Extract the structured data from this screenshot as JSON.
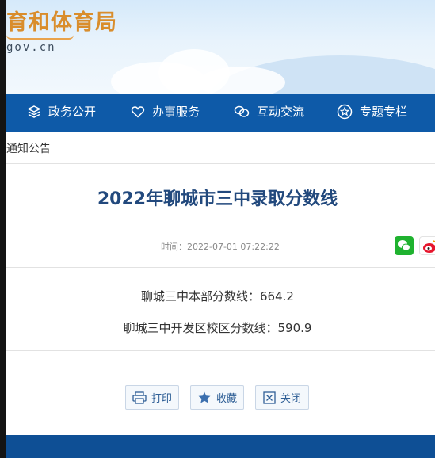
{
  "header": {
    "site_title": "育和体育局",
    "domain": "gov.cn"
  },
  "nav": {
    "items": [
      {
        "label": "政务公开",
        "icon": "layers-icon"
      },
      {
        "label": "办事服务",
        "icon": "heart-icon"
      },
      {
        "label": "互动交流",
        "icon": "chat-icon"
      },
      {
        "label": "专题专栏",
        "icon": "star-icon"
      }
    ]
  },
  "breadcrumb": "通知公告",
  "article": {
    "title": "2022年聊城市三中录取分数线",
    "time": "时间：2022-07-01 07:22:22",
    "lines": [
      "聊城三中本部分数线：664.2",
      "聊城三中开发区校区分数线：590.9"
    ]
  },
  "share": {
    "icons": [
      "wechat-icon",
      "weibo-icon"
    ]
  },
  "actions": {
    "print_label": "打印",
    "favorite_label": "收藏",
    "close_label": "关闭"
  },
  "colors": {
    "nav_bg": "#0e5aa8",
    "title_color": "#22497d",
    "footer_bg": "#0e4f95",
    "wechat_green": "#1fb22f"
  }
}
